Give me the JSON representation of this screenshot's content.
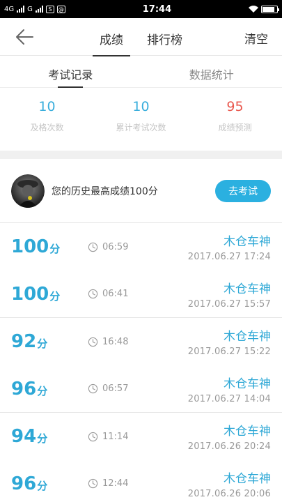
{
  "status": {
    "left_labels": [
      "4G",
      "G"
    ],
    "time": "17:44",
    "icons": [
      "signal-icon",
      "sim-icon",
      "message-icon",
      "wifi-icon",
      "battery-icon"
    ]
  },
  "nav": {
    "tabs": [
      {
        "label": "成绩",
        "active": true
      },
      {
        "label": "排行榜",
        "active": false
      }
    ],
    "clear_label": "清空",
    "back_icon": "back-arrow-icon"
  },
  "sub_tabs": [
    {
      "label": "考试记录",
      "active": true
    },
    {
      "label": "数据统计",
      "active": false
    }
  ],
  "stats": [
    {
      "value": "10",
      "label": "及格次数",
      "color": "#3aaedc"
    },
    {
      "value": "10",
      "label": "累计考试次数",
      "color": "#3aaedc"
    },
    {
      "value": "95",
      "label": "成绩预测",
      "color": "#e9584e"
    }
  ],
  "best": {
    "text": "您的历史最高成绩100分",
    "button_label": "去考试"
  },
  "records": [
    {
      "score": "100",
      "unit": "分",
      "duration": "06:59",
      "user": "木仓车神",
      "date": "2017.06.27  17:24"
    },
    {
      "score": "100",
      "unit": "分",
      "duration": "06:41",
      "user": "木仓车神",
      "date": "2017.06.27  15:57"
    },
    {
      "score": "92",
      "unit": "分",
      "duration": "16:48",
      "user": "木仓车神",
      "date": "2017.06.27  15:22"
    },
    {
      "score": "96",
      "unit": "分",
      "duration": "06:57",
      "user": "木仓车神",
      "date": "2017.06.27  14:04"
    },
    {
      "score": "94",
      "unit": "分",
      "duration": "11:14",
      "user": "木仓车神",
      "date": "2017.06.26  20:24"
    },
    {
      "score": "96",
      "unit": "分",
      "duration": "12:44",
      "user": "木仓车神",
      "date": "2017.06.26  20:06"
    }
  ],
  "colors": {
    "accent": "#2bb0e0",
    "prediction": "#e9584e"
  }
}
